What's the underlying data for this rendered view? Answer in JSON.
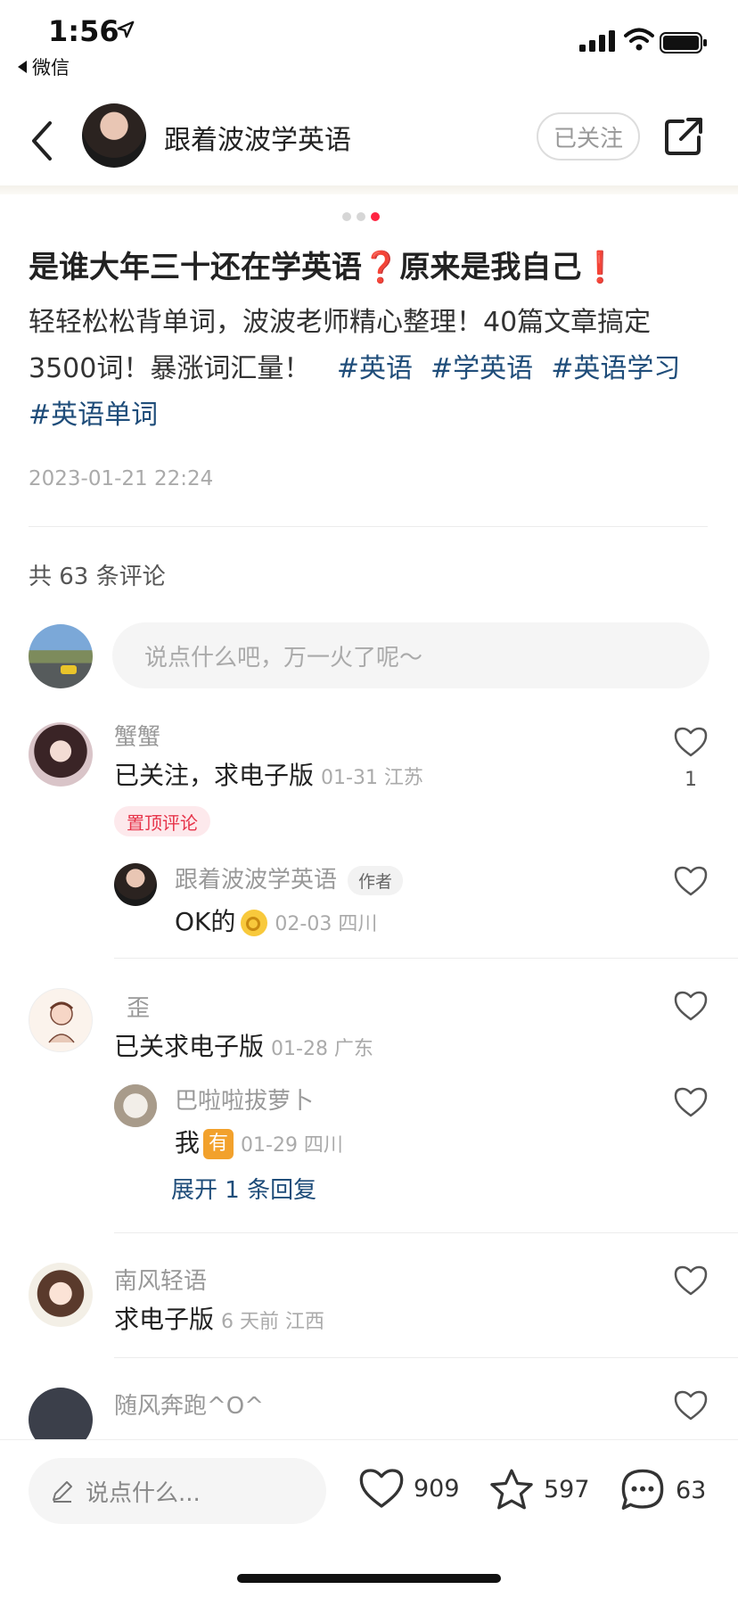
{
  "status_bar": {
    "time": "1:56",
    "back_app_label": "微信"
  },
  "header": {
    "author_name": "跟着波波学英语",
    "follow_label": "已关注"
  },
  "carousel": {
    "count": 3,
    "active_index": 3
  },
  "note": {
    "title_part1": "是谁大年三十还在学英语",
    "title_mark1": "❓",
    "title_part2": "原来是我自己",
    "title_mark2": "❗",
    "body_text": "轻轻松松背单词，波波老师精心整理！40篇文章搞定3500词！暴涨词汇量！",
    "tags": [
      "#英语",
      "#学英语",
      "#英语学习",
      "#英语单词"
    ],
    "date": "2023-01-21 22:24"
  },
  "comments_section": {
    "count_label": "共 63 条评论",
    "input_placeholder": "说点什么吧，万一火了呢～"
  },
  "comments": [
    {
      "name": "蟹蟹",
      "text": "已关注，求电子版",
      "meta": "01-31 江苏",
      "likes": "1",
      "pinned_label": "置顶评论",
      "reply": {
        "name": "跟着波波学英语",
        "badge": "作者",
        "text": "OK的",
        "emoji": "ok-hand-emoji",
        "meta": "02-03 四川"
      }
    },
    {
      "name": "歪",
      "text": "已关求电子版",
      "meta": "01-28 广东",
      "reply": {
        "name": "巴啦啦拔萝卜",
        "text": "我",
        "emoji_text": "有",
        "meta": "01-29 四川"
      },
      "expand_label": "展开 1 条回复"
    },
    {
      "name": "南风轻语",
      "text": "求电子版",
      "meta": "6 天前 江西"
    },
    {
      "name": "随风奔跑^O^"
    }
  ],
  "bottom_bar": {
    "input_placeholder": "说点什么...",
    "likes": "909",
    "collects": "597",
    "comments": "63"
  },
  "colors": {
    "accent_red": "#ff2442",
    "tag_blue": "#1f4d7a"
  }
}
